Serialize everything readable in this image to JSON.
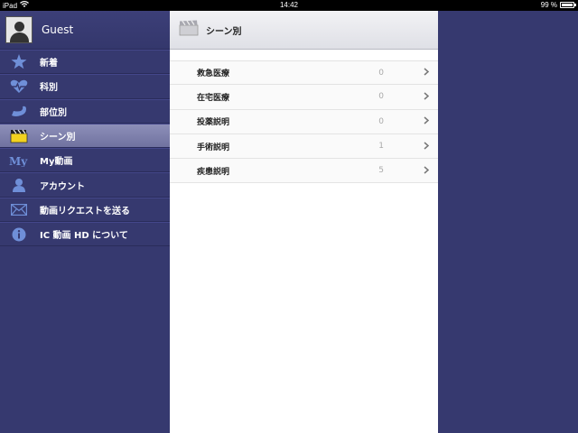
{
  "status_bar": {
    "device": "iPad",
    "time": "14:42",
    "battery": "99 %",
    "battery_level": 0.99
  },
  "sidebar": {
    "user": {
      "name": "Guest"
    },
    "items": [
      {
        "label": "新着",
        "icon": "star-icon",
        "active": false
      },
      {
        "label": "科別",
        "icon": "heart-pulse-icon",
        "active": false
      },
      {
        "label": "部位別",
        "icon": "arm-icon",
        "active": false
      },
      {
        "label": "シーン別",
        "icon": "clapperboard-icon",
        "active": true
      },
      {
        "label": "My動画",
        "icon": "my-icon",
        "active": false
      },
      {
        "label": "アカウント",
        "icon": "person-icon",
        "active": false
      },
      {
        "label": "動画リクエストを送る",
        "icon": "mail-icon",
        "active": false
      },
      {
        "label": "IC 動画 HD について",
        "icon": "info-icon",
        "active": false
      }
    ]
  },
  "panel": {
    "title": "シーン別",
    "title_icon": "clapperboard-icon",
    "rows": [
      {
        "label": "救急医療",
        "count": "0"
      },
      {
        "label": "在宅医療",
        "count": "0"
      },
      {
        "label": "投薬説明",
        "count": "0"
      },
      {
        "label": "手術説明",
        "count": "1"
      },
      {
        "label": "疾患説明",
        "count": "5"
      }
    ]
  },
  "colors": {
    "background": "#36396f",
    "active_item": "#7f81ad",
    "icon": "#6f8fd8"
  }
}
